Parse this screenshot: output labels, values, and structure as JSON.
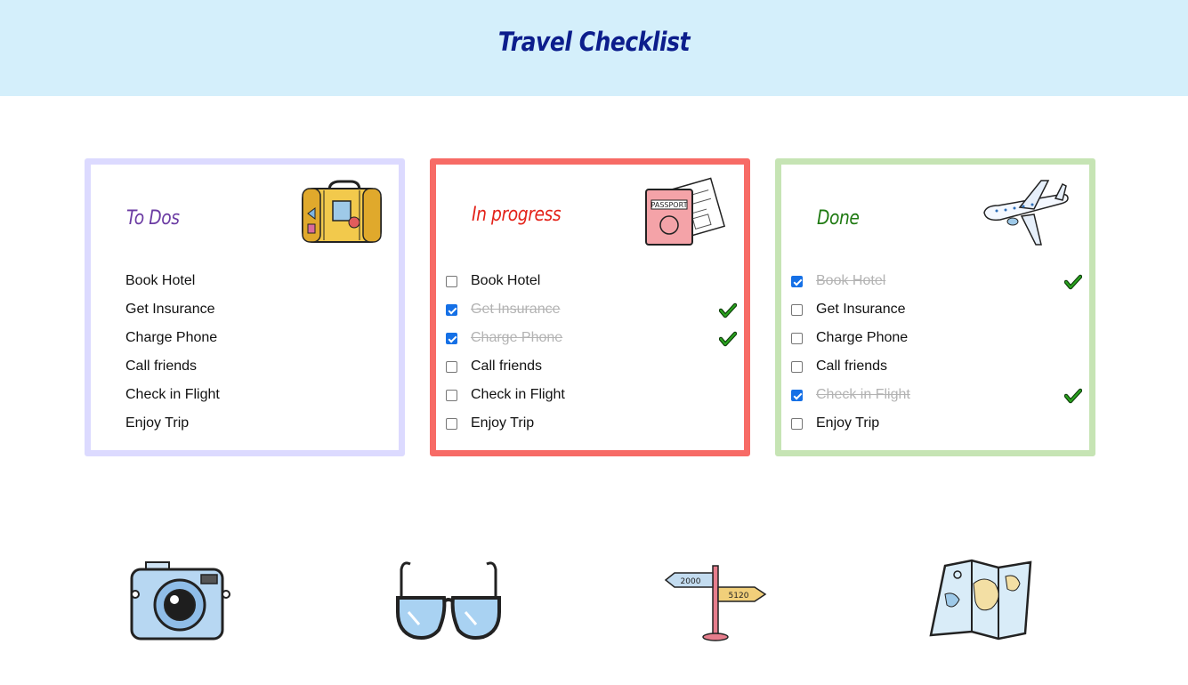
{
  "header": {
    "title": "Travel Checklist"
  },
  "colors": {
    "header_bg": "#d4effb",
    "title": "#0c1d8c",
    "todo_border": "#dcdaff",
    "progress_border": "#f76b66",
    "done_border": "#c6e4b4",
    "check_accent": "#1570e6",
    "tick": "#2aa31f"
  },
  "panels": [
    {
      "title": "To Dos",
      "illustration": "suitcase-icon",
      "items": [
        {
          "label": "Book Hotel"
        },
        {
          "label": "Get Insurance"
        },
        {
          "label": "Charge Phone"
        },
        {
          "label": "Call friends"
        },
        {
          "label": "Check in Flight"
        },
        {
          "label": "Enjoy Trip"
        }
      ]
    },
    {
      "title": "In progress",
      "illustration": "passport-icon",
      "items": [
        {
          "label": "Book Hotel",
          "checked": false
        },
        {
          "label": "Get Insurance",
          "checked": true
        },
        {
          "label": "Charge Phone",
          "checked": true
        },
        {
          "label": "Call friends",
          "checked": false
        },
        {
          "label": "Check in Flight",
          "checked": false
        },
        {
          "label": "Enjoy Trip",
          "checked": false
        }
      ]
    },
    {
      "title": "Done",
      "illustration": "airplane-icon",
      "items": [
        {
          "label": "Book Hotel",
          "checked": true
        },
        {
          "label": "Get Insurance",
          "checked": false
        },
        {
          "label": "Charge Phone",
          "checked": false
        },
        {
          "label": "Call friends",
          "checked": false
        },
        {
          "label": "Check in Flight",
          "checked": true
        },
        {
          "label": "Enjoy Trip",
          "checked": false
        }
      ]
    }
  ],
  "bottom_icons": [
    "camera-icon",
    "sunglasses-icon",
    "signpost-icon",
    "map-icon"
  ],
  "signpost": {
    "left_sign": "2000",
    "right_sign": "5120"
  }
}
